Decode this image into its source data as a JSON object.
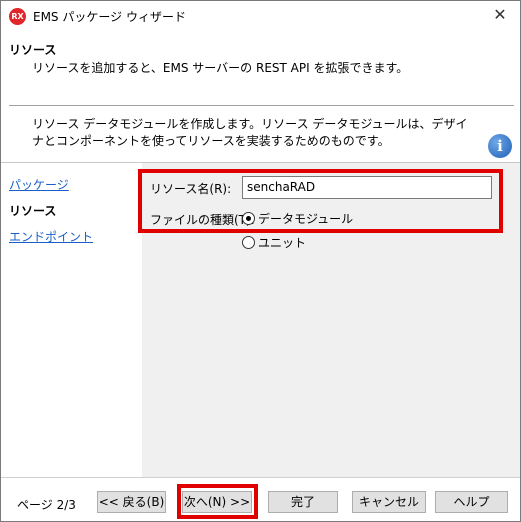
{
  "window": {
    "app_icon": "RX",
    "title": "EMS パッケージ ウィザード",
    "close_label": "✕"
  },
  "header": {
    "title": "リソース",
    "description": "リソースを追加すると、EMS サーバーの REST API を拡張できます。"
  },
  "info": {
    "text": "リソース データモジュールを作成します。リソース データモジュールは、デザイナとコンポーネントを使ってリソースを実装するためのものです。",
    "icon": "info-icon",
    "icon_glyph": "i"
  },
  "nav": {
    "items": [
      {
        "label": "パッケージ",
        "active": false
      },
      {
        "label": "リソース",
        "active": true
      },
      {
        "label": "エンドポイント",
        "active": false
      }
    ]
  },
  "form": {
    "resource_name_label": "リソース名(R):",
    "resource_name_value": "senchaRAD",
    "file_type_label": "ファイルの種類(T):",
    "file_type_options": [
      {
        "label": "データモジュール",
        "selected": true
      },
      {
        "label": "ユニット",
        "selected": false
      }
    ]
  },
  "footer": {
    "page_indicator": "ページ 2/3",
    "back_label": "<< 戻る(B)",
    "next_label": "次へ(N) >>",
    "finish_label": "完了",
    "cancel_label": "キャンセル",
    "help_label": "ヘルプ"
  },
  "colors": {
    "highlight": "#e00000",
    "link": "#1a5fc9",
    "content_bg": "#f0f0f0"
  }
}
